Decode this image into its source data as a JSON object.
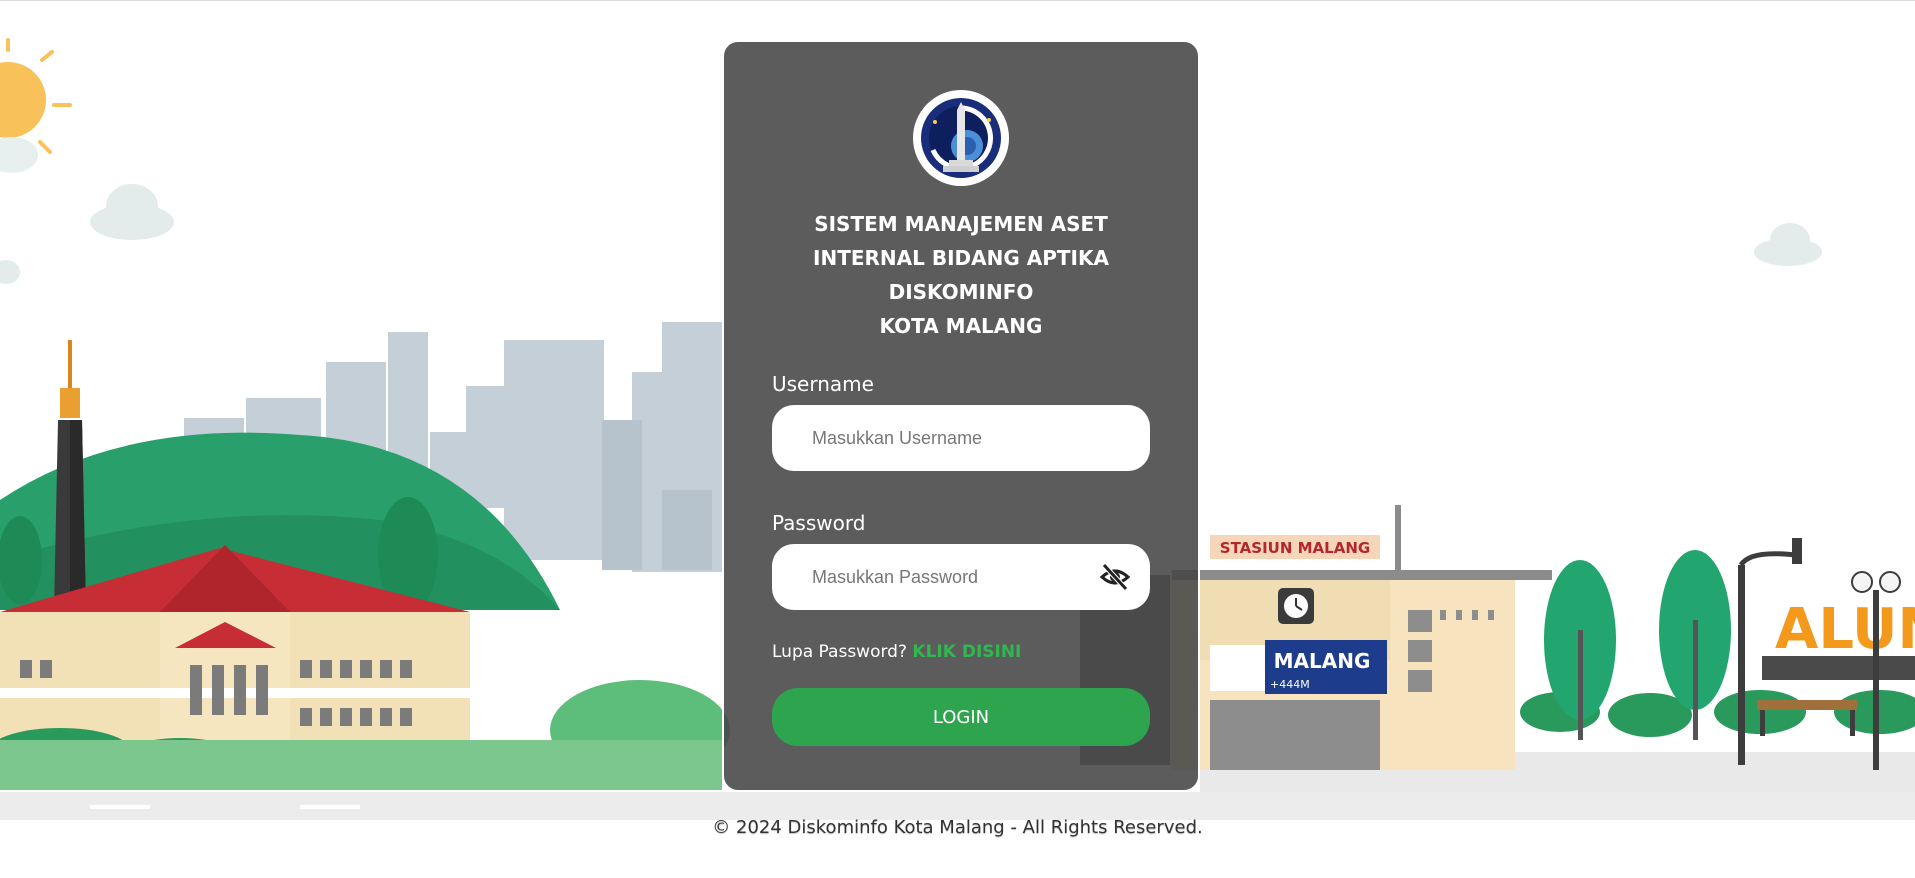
{
  "app": {
    "title_lines": [
      "SISTEM MANAJEMEN ASET",
      "INTERNAL BIDANG APTIKA",
      "DISKOMINFO",
      "KOTA MALANG"
    ]
  },
  "form": {
    "username_label": "Username",
    "username_placeholder": "Masukkan Username",
    "password_label": "Password",
    "password_placeholder": "Masukkan Password",
    "forgot_text": "Lupa Password?",
    "forgot_link": "KLIK DISINI",
    "login_label": "LOGIN"
  },
  "background": {
    "station_sign": "STASIUN MALANG",
    "station_name": "MALANG",
    "station_elevation": "+444M",
    "alun_sign": "ALUN"
  },
  "footer": {
    "text": "© 2024 Diskominfo Kota Malang - All Rights Reserved."
  },
  "colors": {
    "accent": "#2ea44f",
    "link": "#31b74f",
    "card": "#4a4a4a",
    "hill": "#2a9a6a"
  },
  "icons": {
    "password_toggle": "eye-slash-icon",
    "logo": "kota-malang-emblem"
  }
}
